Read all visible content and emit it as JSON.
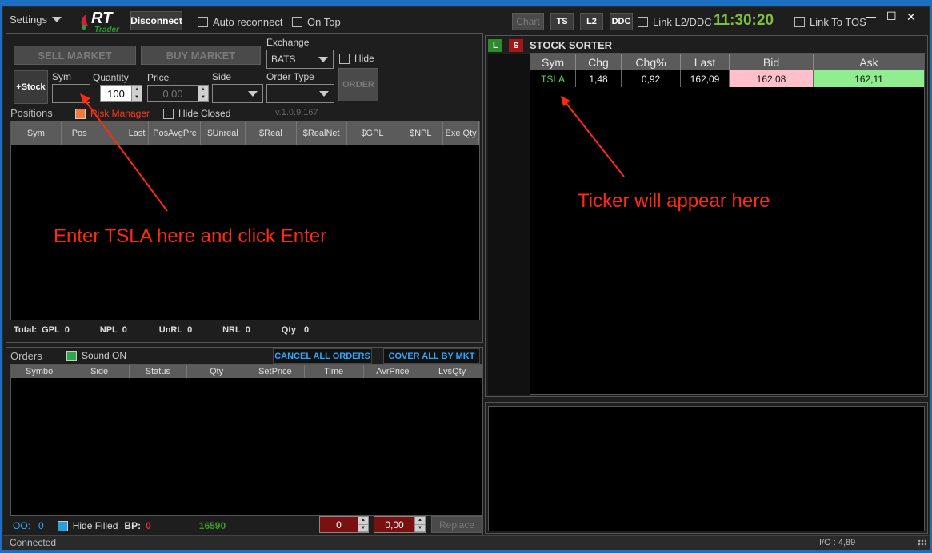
{
  "titlebar": {
    "settings_label": "Settings",
    "logo_text": "RT",
    "logo_sub": "Trader",
    "disconnect_label": "Disconnect",
    "auto_reconnect_label": "Auto reconnect",
    "on_top_label": "On Top",
    "chart_label": "Chart",
    "ts_label": "TS",
    "l2_label": "L2",
    "ddc_label": "DDC",
    "link_l2_label": "Link L2/DDC",
    "clock": "11:30:20",
    "link_tos_label": "Link To TOS",
    "minimize_glyph": "—",
    "maximize_glyph": "☐",
    "close_glyph": "✕"
  },
  "order_entry": {
    "sell_market_label": "SELL MARKET",
    "buy_market_label": "BUY MARKET",
    "exchange_label": "Exchange",
    "exchange_value": "BATS",
    "hide_label": "Hide",
    "add_stock_label": "+Stock",
    "sym_label": "Sym",
    "sym_value": "",
    "quantity_label": "Quantity",
    "quantity_value": "100",
    "price_label": "Price",
    "price_value": "0,00",
    "side_label": "Side",
    "side_value": "",
    "order_type_label": "Order Type",
    "order_type_value": "",
    "order_button_label": "ORDER"
  },
  "positions": {
    "title": "Positions",
    "risk_manager_label": "Risk Manager",
    "hide_closed_label": "Hide Closed",
    "version": "v.1.0.9.167",
    "columns": [
      "Sym",
      "Pos",
      "Last",
      "PosAvgPrc",
      "$Unreal",
      "$Real",
      "$RealNet",
      "$GPL",
      "$NPL",
      "Exe Qty"
    ],
    "totals": {
      "total_label": "Total:",
      "gpl_label": "GPL",
      "gpl_value": "0",
      "npl_label": "NPL",
      "npl_value": "0",
      "unrl_label": "UnRL",
      "unrl_value": "0",
      "nrl_label": "NRL",
      "nrl_value": "0",
      "qty_label": "Qty",
      "qty_value": "0"
    }
  },
  "orders": {
    "title": "Orders",
    "sound_label": "Sound ON",
    "cancel_all_label": "CANCEL ALL ORDERS",
    "cover_all_label": "COVER ALL BY MKT",
    "columns": [
      "Symbol",
      "Side",
      "Status",
      "Qty",
      "SetPrice",
      "Time",
      "AvrPrice",
      "LvsQty"
    ],
    "oo_label": "OO:",
    "oo_value": "0",
    "hide_filled_label": "Hide Filled",
    "bp_label": "BP:",
    "bp_value": "0",
    "bp_amount": "16590",
    "qty_value": "0",
    "price_value": "0,00",
    "replace_label": "Replace"
  },
  "sorter": {
    "l_label": "L",
    "s_label": "S",
    "title": "STOCK SORTER",
    "columns": [
      "Sym",
      "Chg",
      "Chg%",
      "Last",
      "Bid",
      "Ask"
    ],
    "row": {
      "sym": "TSLA",
      "chg": "1,48",
      "chg_pct": "0,92",
      "last": "162,09",
      "bid": "162,08",
      "ask": "162,11"
    }
  },
  "annotations": {
    "enter_note": "Enter TSLA here and click Enter",
    "ticker_note": "Ticker will appear here"
  },
  "statusbar": {
    "status": "Connected",
    "io": "I/O : 4,89"
  },
  "colors": {
    "clock": "#7fbf3f",
    "annotation": "#ff2a12",
    "bid_bg": "#ffc0cb",
    "ask_bg": "#90ee90",
    "link_blue": "#2fa8ff"
  }
}
